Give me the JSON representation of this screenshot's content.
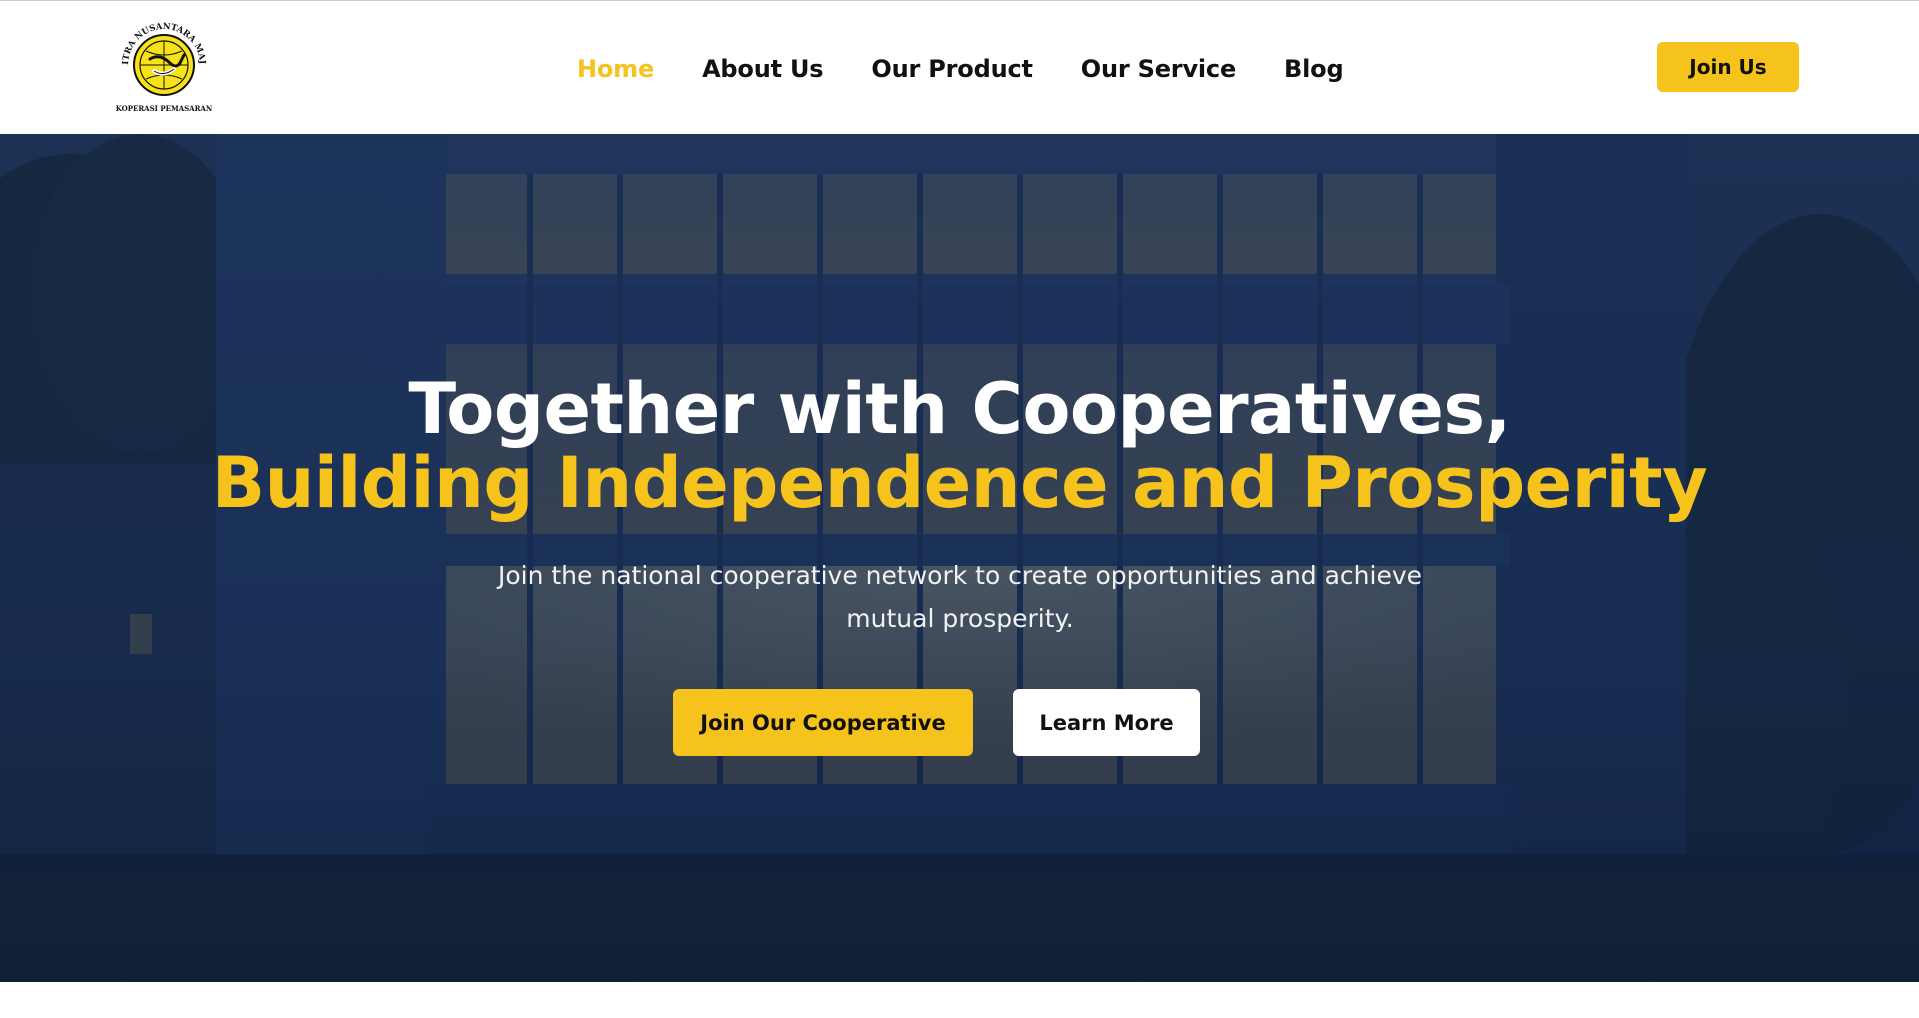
{
  "logo": {
    "top_text": "CITRA NUSANTARA MAJU",
    "bottom_text": "KOPERASI PEMASARAN",
    "icon": "globe-handshake-logo"
  },
  "nav": {
    "items": [
      {
        "label": "Home",
        "active": true
      },
      {
        "label": "About Us",
        "active": false
      },
      {
        "label": "Our Product",
        "active": false
      },
      {
        "label": "Our Service",
        "active": false
      },
      {
        "label": "Blog",
        "active": false
      }
    ]
  },
  "header": {
    "join_label": "Join Us"
  },
  "hero": {
    "headline_line1": "Together with Cooperatives,",
    "headline_line2": "Building Independence and Prosperity",
    "subtitle": "Join the national cooperative network to create opportunities and achieve mutual prosperity.",
    "primary_cta": "Join Our Cooperative",
    "secondary_cta": "Learn More",
    "background": "office-building-night-photo"
  },
  "colors": {
    "accent": "#f6c21c",
    "hero_overlay": "#12264a",
    "text_dark": "#111111",
    "white": "#ffffff"
  }
}
